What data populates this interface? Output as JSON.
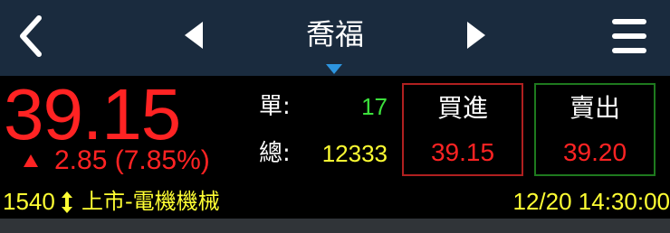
{
  "header": {
    "title": "喬福",
    "colors": {
      "background": "#1a2b3e",
      "dropdown_accent": "#2d95e0"
    }
  },
  "quote": {
    "price": "39.15",
    "change": "2.85",
    "change_percent": "(7.85%)",
    "direction": "up",
    "single_label": "單:",
    "single_volume": "17",
    "total_label": "總:",
    "total_volume": "12333"
  },
  "order": {
    "buy_label": "買進",
    "buy_price": "39.15",
    "sell_label": "賣出",
    "sell_price": "39.20"
  },
  "footer": {
    "code": "1540",
    "market": "上市-電機機械",
    "datetime": "12/20 14:30:00"
  },
  "icons": [
    "back-icon",
    "prev-arrow-icon",
    "next-arrow-icon",
    "dropdown-triangle-icon",
    "menu-icon",
    "up-triangle-icon",
    "market-updown-icon"
  ],
  "colors": {
    "up": "#ff2323",
    "single_volume": "#3ce03c",
    "yellow": "#ffff33",
    "buy_border": "#b02020",
    "sell_border": "#1e7a1e"
  }
}
